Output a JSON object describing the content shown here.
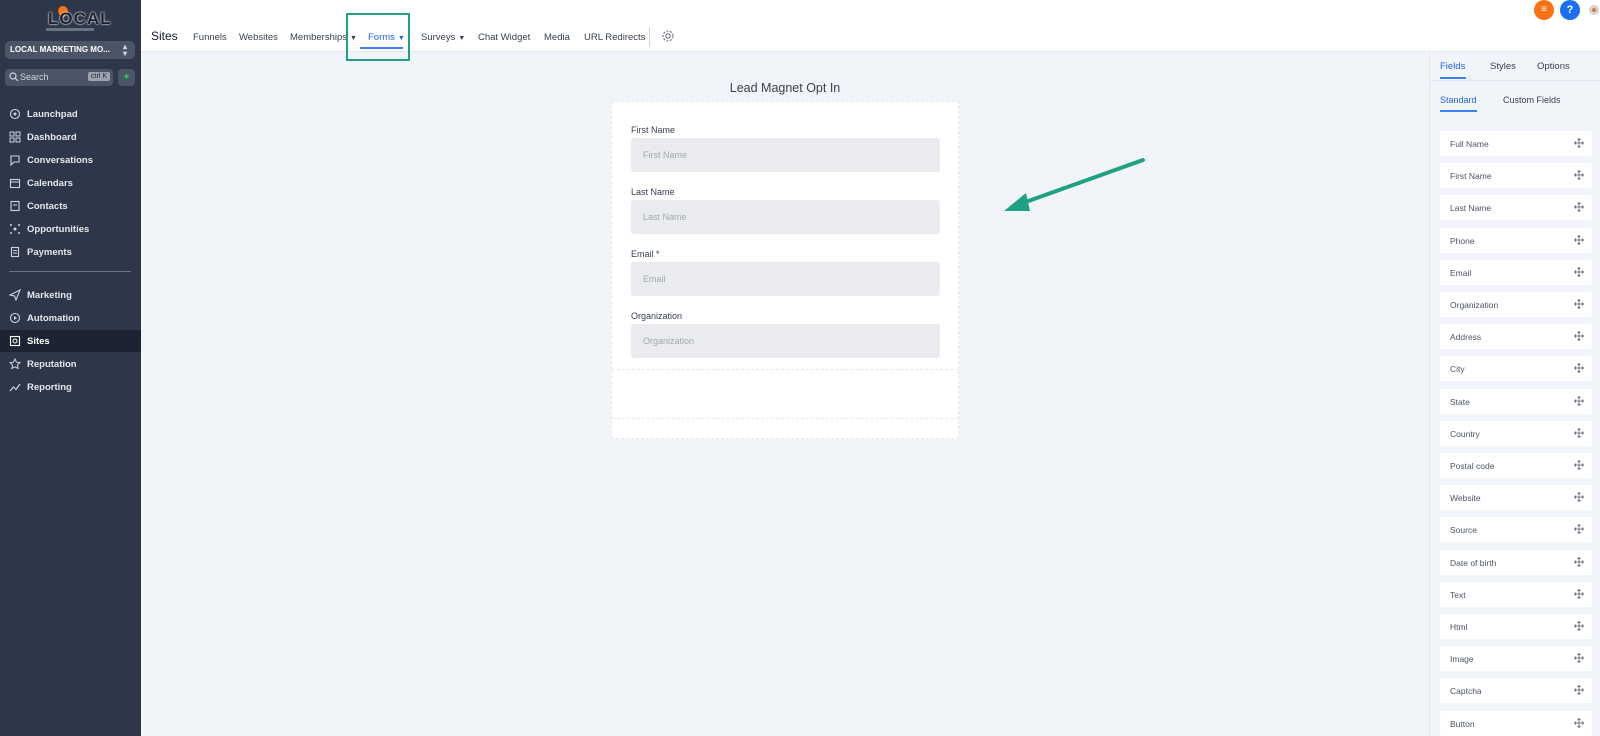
{
  "sidebar": {
    "logo_text": "LOCAL",
    "account_name": "LOCAL MARKETING MO...",
    "search_placeholder": "Search",
    "search_shortcut": "ctrl K",
    "nav": [
      {
        "label": "Launchpad",
        "icon": "rocket-icon"
      },
      {
        "label": "Dashboard",
        "icon": "grid-icon"
      },
      {
        "label": "Conversations",
        "icon": "chat-icon"
      },
      {
        "label": "Calendars",
        "icon": "calendar-icon"
      },
      {
        "label": "Contacts",
        "icon": "contacts-icon"
      },
      {
        "label": "Opportunities",
        "icon": "opportunities-icon"
      },
      {
        "label": "Payments",
        "icon": "payments-icon"
      }
    ],
    "nav2": [
      {
        "label": "Marketing",
        "icon": "send-icon"
      },
      {
        "label": "Automation",
        "icon": "automation-icon"
      },
      {
        "label": "Sites",
        "icon": "sites-icon",
        "active": true
      },
      {
        "label": "Reputation",
        "icon": "star-icon"
      },
      {
        "label": "Reporting",
        "icon": "chart-line-icon"
      }
    ]
  },
  "topbar": {
    "title": "Sites",
    "tabs": [
      {
        "label": "Funnels"
      },
      {
        "label": "Websites"
      },
      {
        "label": "Memberships",
        "dropdown": true
      },
      {
        "label": "Forms",
        "dropdown": true,
        "active": true
      },
      {
        "label": "Surveys",
        "dropdown": true
      },
      {
        "label": "Chat Widget"
      },
      {
        "label": "Media"
      },
      {
        "label": "URL Redirects"
      }
    ],
    "accent": "#2563eb",
    "highlight_color": "#21a184"
  },
  "form": {
    "title": "Lead Magnet Opt In",
    "fields": [
      {
        "label": "First Name",
        "placeholder": "First Name"
      },
      {
        "label": "Last Name",
        "placeholder": "Last Name"
      },
      {
        "label": "Email *",
        "placeholder": "Email"
      },
      {
        "label": "Organization",
        "placeholder": "Organization"
      }
    ]
  },
  "right_panel": {
    "tabs": [
      "Fields",
      "Styles",
      "Options"
    ],
    "subtabs": [
      "Standard",
      "Custom Fields"
    ],
    "items": [
      "Full Name",
      "First Name",
      "Last Name",
      "Phone",
      "Email",
      "Organization",
      "Address",
      "City",
      "State",
      "Country",
      "Postal code",
      "Website",
      "Source",
      "Date of birth",
      "Text",
      "Html",
      "Image",
      "Captcha",
      "Button"
    ]
  }
}
